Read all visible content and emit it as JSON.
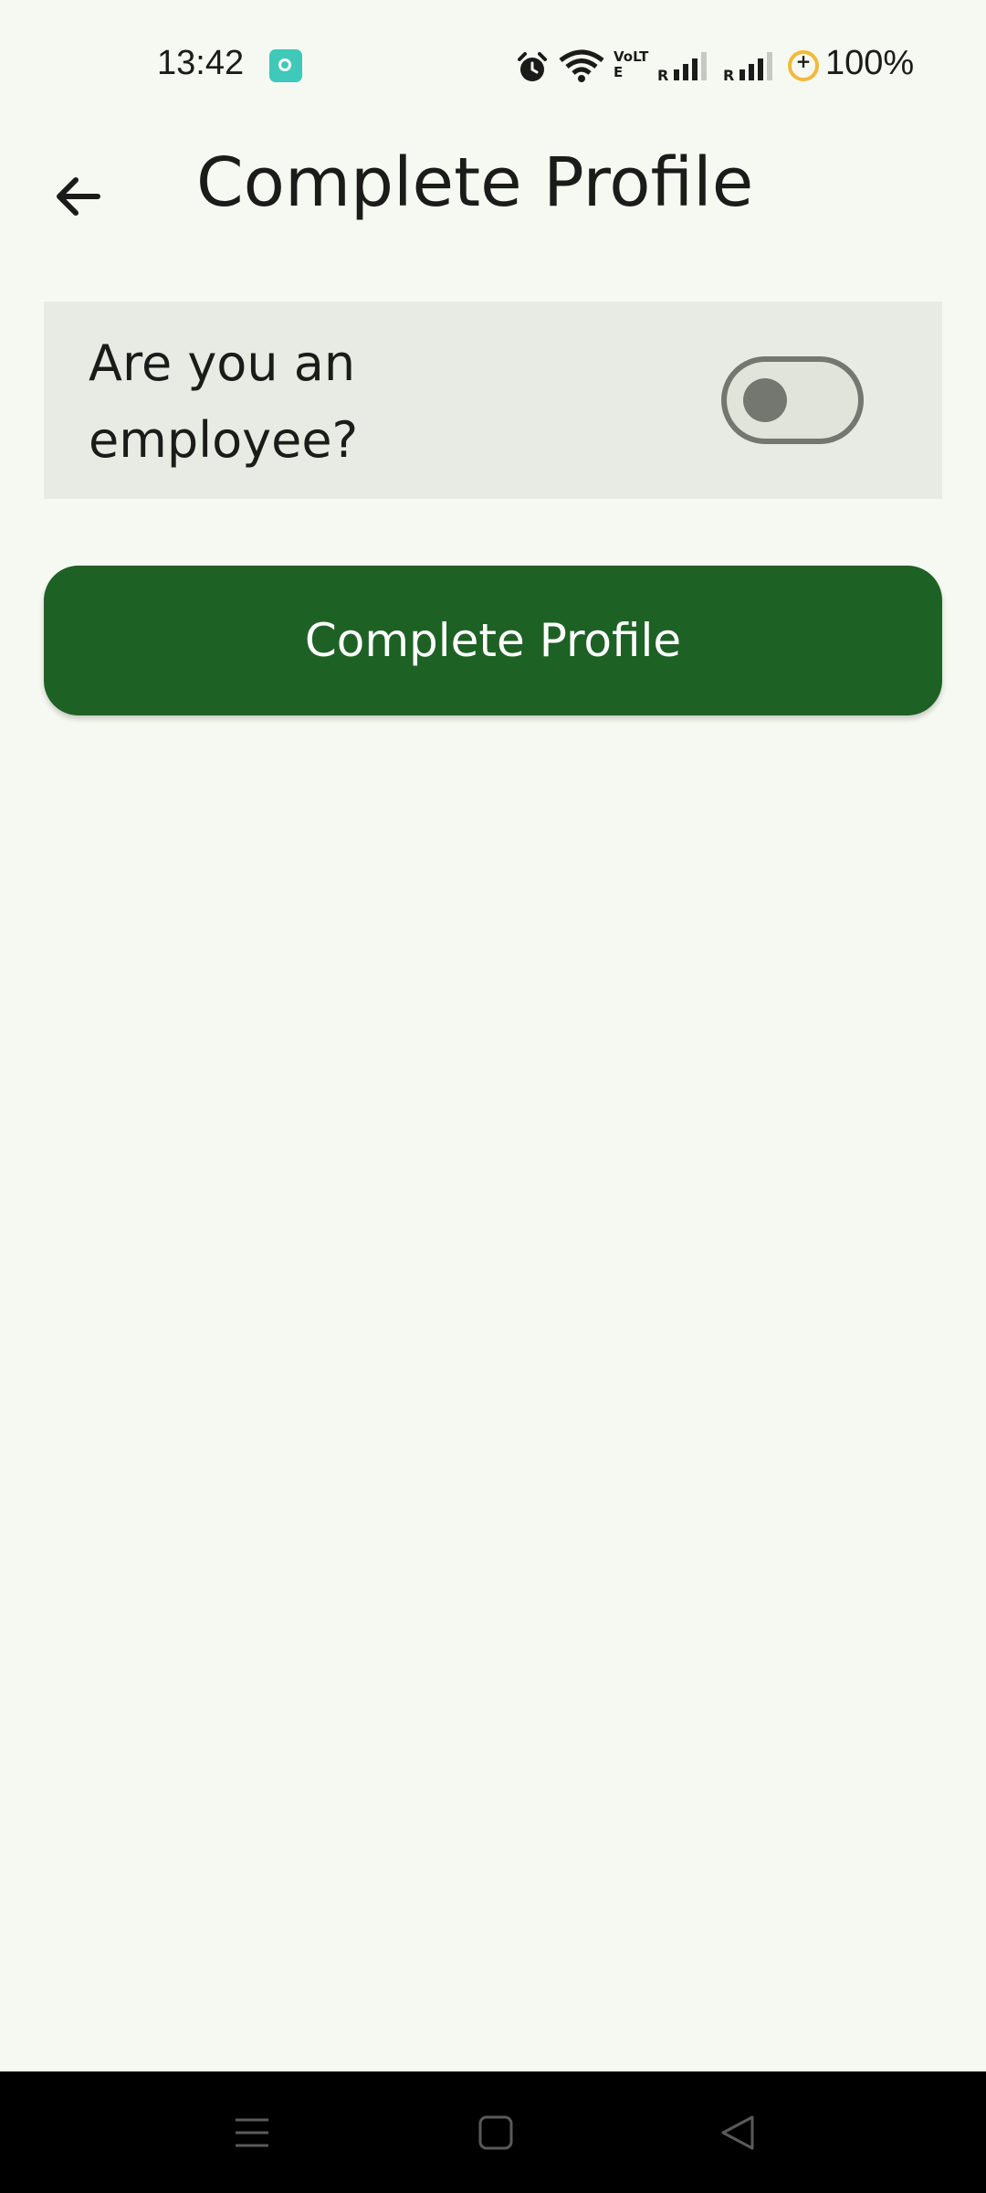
{
  "status_bar": {
    "time": "13:42",
    "volte": "VoLTE",
    "battery": "100%",
    "icons": [
      "app-notification-icon",
      "alarm-icon",
      "wifi-icon",
      "volte-icon",
      "signal-icon",
      "signal-icon",
      "battery-saver-icon"
    ]
  },
  "header": {
    "back_icon": "arrow-left-icon",
    "title": "Complete Profile"
  },
  "employee_card": {
    "label": "Are you an employee?",
    "toggle_on": false
  },
  "actions": {
    "complete_label": "Complete Profile"
  },
  "nav_bar": {
    "icons": [
      "menu-icon",
      "home-icon",
      "back-triangle-icon"
    ]
  },
  "colors": {
    "background": "#f6f9f1",
    "card": "#e8ebe3",
    "primary": "#1e6124",
    "toggle_outline": "#73776f",
    "nav_bar": "#000000"
  }
}
